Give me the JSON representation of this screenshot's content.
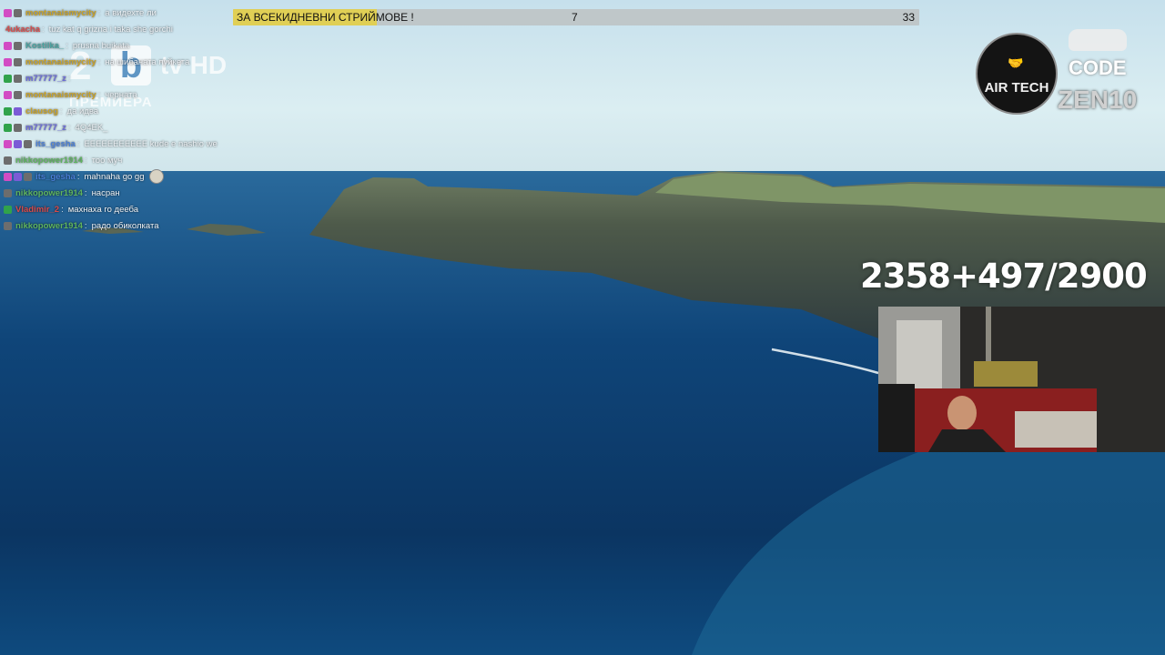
{
  "goal": {
    "label": "ЗА ВСЕКИДНЕВНИ СТРИЙМОВЕ !",
    "current": "7",
    "target": "33",
    "progress_fraction": 0.21,
    "bar_color": "#bfc7c9",
    "fill_color": "#e0cf55"
  },
  "channel_logo": {
    "number": "2",
    "letter": "b",
    "tv": "tv HD",
    "subtitle": "ПРЕМИЕРА"
  },
  "chat": {
    "messages": [
      {
        "badges": [
          "sub",
          "prime"
        ],
        "user": "montanaismycity",
        "user_color": "#c9a227",
        "text": "а видехте ли",
        "faded": false,
        "emote": false
      },
      {
        "badges": [],
        "user": "4ukacha",
        "user_color": "#d94b4b",
        "text": "tuz kat q grizna i taka she gorchi",
        "faded": false,
        "emote": false
      },
      {
        "badges": [
          "sub",
          "prime"
        ],
        "user": "Kostilka_",
        "user_color": "#4aa3a0",
        "text": "prusna buikata",
        "faded": false,
        "emote": false
      },
      {
        "badges": [
          "sub",
          "prime"
        ],
        "user": "montanaismycity",
        "user_color": "#c9a227",
        "text": "на шибаната пуйкета",
        "faded": false,
        "emote": false
      },
      {
        "badges": [
          "mod",
          "prime"
        ],
        "user": "m77777_z",
        "user_color": "#6a6ad8",
        "text": "",
        "faded": false,
        "emote": false
      },
      {
        "badges": [
          "sub",
          "prime"
        ],
        "user": "montanaismycity",
        "user_color": "#c9a227",
        "text": "черната",
        "faded": false,
        "emote": false
      },
      {
        "badges": [
          "mod",
          "bits"
        ],
        "user": "clausog",
        "user_color": "#c9a227",
        "text": "да идва",
        "faded": false,
        "emote": false
      },
      {
        "badges": [
          "mod",
          "prime"
        ],
        "user": "m77777_z",
        "user_color": "#6a6ad8",
        "text": "4Q4EK_",
        "faded": false,
        "emote": false
      },
      {
        "badges": [
          "sub",
          "bits",
          "prime"
        ],
        "user": "its_gesha",
        "user_color": "#4a7fd8",
        "text": "EEEEEEEEEEE kude e nashio we",
        "faded": false,
        "emote": false
      },
      {
        "badges": [
          "prime"
        ],
        "user": "nikkopower1914",
        "user_color": "#5fb45f",
        "text": "тоо муч",
        "faded": false,
        "emote": false
      },
      {
        "badges": [
          "sub",
          "bits",
          "prime"
        ],
        "user": "its_gesha",
        "user_color": "#4a7fd8",
        "text": "mahnaha go gg",
        "faded": false,
        "emote": true
      },
      {
        "badges": [
          "prime"
        ],
        "user": "nikkopower1914",
        "user_color": "#5fb45f",
        "text": "насран",
        "faded": false,
        "emote": false
      },
      {
        "badges": [
          "mod"
        ],
        "user": "Vladimir_2",
        "user_color": "#d94b4b",
        "text": "махнаха го дееба",
        "faded": false,
        "emote": false
      },
      {
        "badges": [
          "prime"
        ],
        "user": "nikkopower1914",
        "user_color": "#5fb45f",
        "text": "радо обиколката",
        "faded": false,
        "emote": false
      }
    ]
  },
  "sponsor": {
    "brand": "AIR TECH",
    "code_label": "CODE",
    "code_value": "ZEN10"
  },
  "counter": {
    "text": "2358+497/2900"
  },
  "colors": {
    "sea_deep": "#0d3a66",
    "sky": "#d6ecf1",
    "cliff": "#4b5b4a"
  }
}
